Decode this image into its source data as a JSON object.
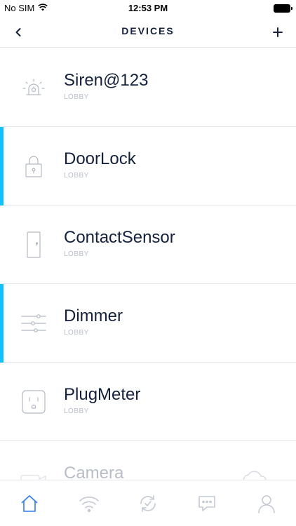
{
  "status": {
    "carrier": "No SIM",
    "time": "12:53 PM"
  },
  "nav": {
    "title": "DEVICES"
  },
  "devices": [
    {
      "name": "Siren@123",
      "room": "LOBBY",
      "icon": "siren-icon",
      "active": false
    },
    {
      "name": "DoorLock",
      "room": "LOBBY",
      "icon": "lock-icon",
      "active": true
    },
    {
      "name": "ContactSensor",
      "room": "LOBBY",
      "icon": "door-contact-icon",
      "active": false
    },
    {
      "name": "Dimmer",
      "room": "LOBBY",
      "icon": "sliders-icon",
      "active": true
    },
    {
      "name": "PlugMeter",
      "room": "LOBBY",
      "icon": "outlet-icon",
      "active": false
    },
    {
      "name": "Camera",
      "room": "",
      "icon": "camera-icon",
      "active": false
    }
  ],
  "tabs": [
    {
      "icon": "home-icon",
      "selected": true
    },
    {
      "icon": "wifi-icon",
      "selected": false
    },
    {
      "icon": "sync-icon",
      "selected": false
    },
    {
      "icon": "chat-icon",
      "selected": false
    },
    {
      "icon": "user-icon",
      "selected": false
    }
  ],
  "colors": {
    "accent": "#14c1ff",
    "text": "#14213d",
    "muted": "#b9bfca",
    "tab_active": "#2b7de9",
    "tab_inactive": "#c4c9d3"
  }
}
